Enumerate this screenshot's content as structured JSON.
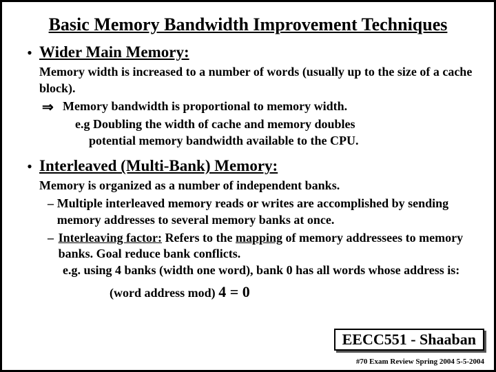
{
  "title": "Basic Memory Bandwidth Improvement Techniques",
  "b1": {
    "heading": "Wider Main Memory:",
    "p1": "Memory width is increased to a number of words  (usually up to the size of a cache block).",
    "arrow": "Memory bandwidth is proportional to memory width.",
    "eg1": "e.g  Doubling the width of cache and memory doubles",
    "eg2": "potential memory bandwidth available to the CPU."
  },
  "b2": {
    "heading": "Interleaved (Multi-Bank) Memory:",
    "p1": "Memory is organized as a number of independent banks.",
    "d1": "Multiple  interleaved memory reads or writes are accomplished by sending memory addresses to several memory banks at once.",
    "d2a": "Interleaving factor:",
    "d2b": "  Refers to the ",
    "d2c": "mapping",
    "d2d": " of memory addressees to memory banks.   Goal reduce bank conflicts.",
    "eg": " e.g.  using 4 banks (width one word), bank 0 has all words whose address is:",
    "eq_pre": "(word address mod)  ",
    "eq_val": "4  =  0"
  },
  "footer": {
    "box": "EECC551 - Shaaban",
    "small": "#70   Exam Review  Spring 2004  5-5-2004"
  }
}
